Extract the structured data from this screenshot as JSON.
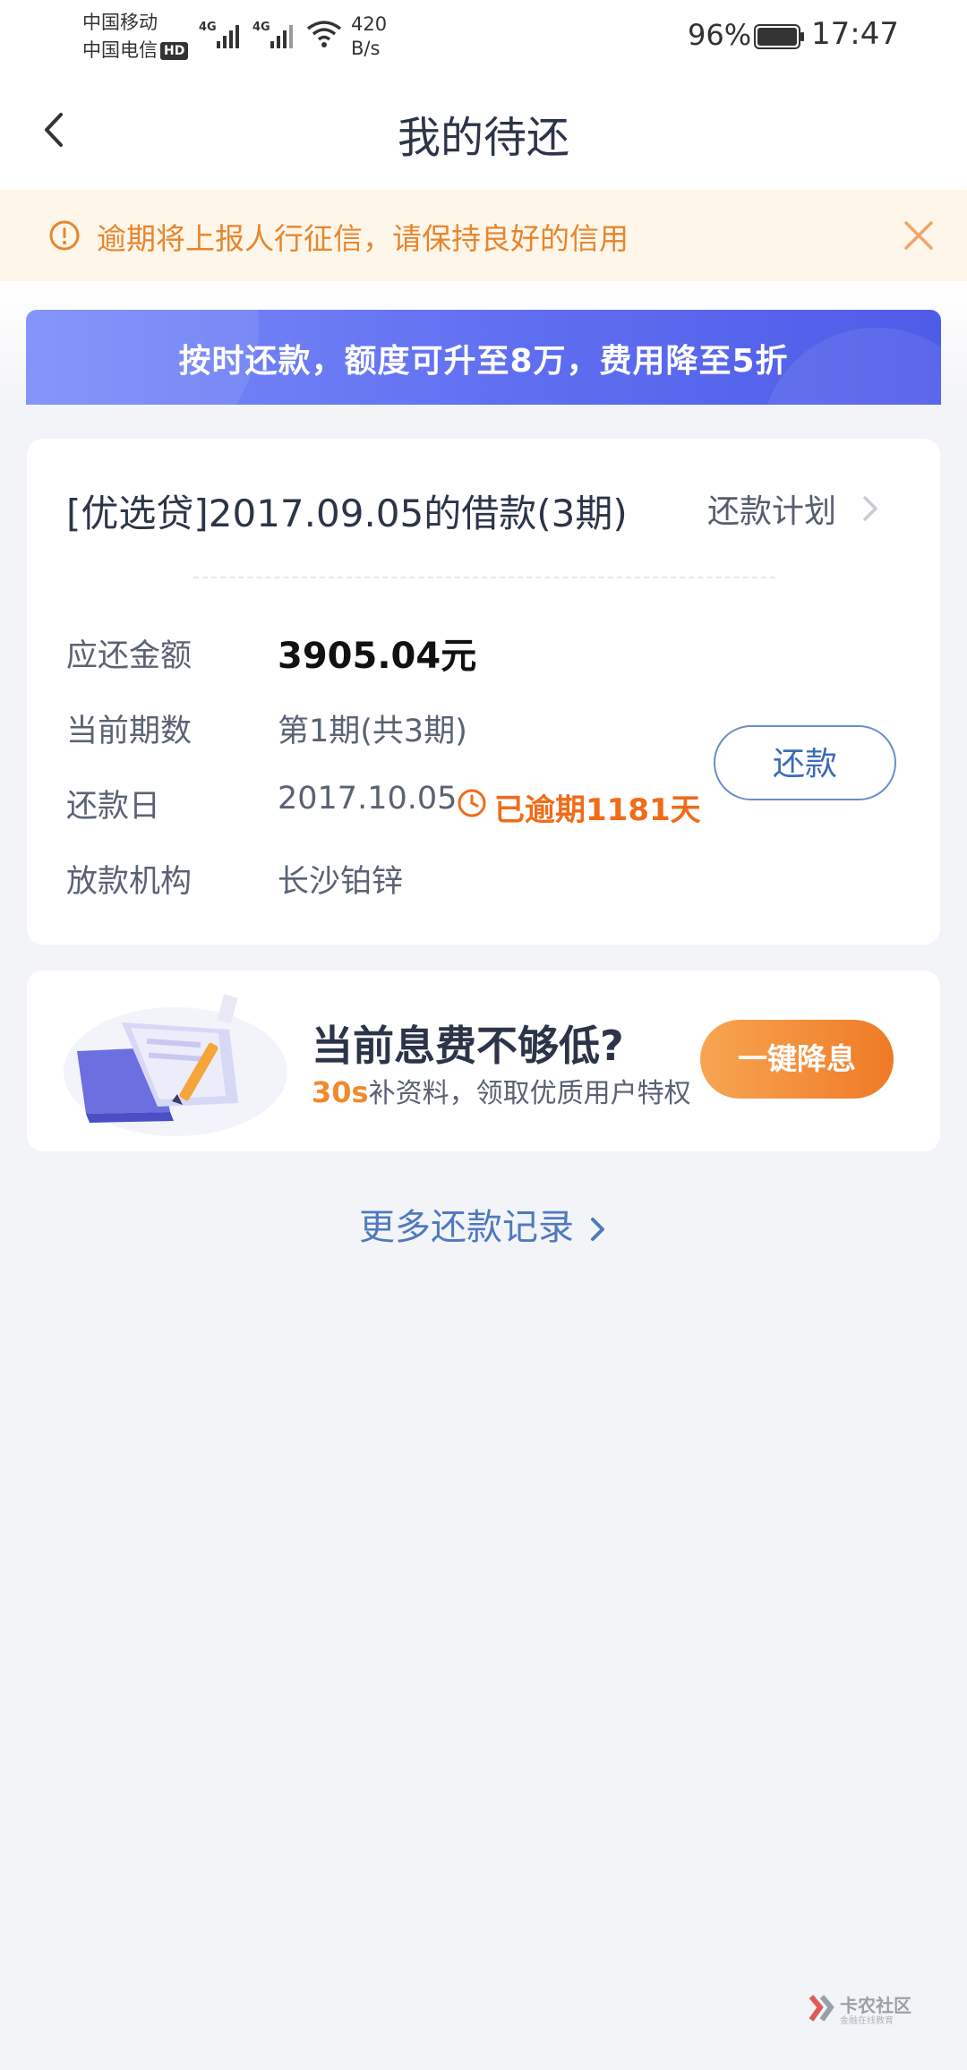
{
  "status_bar": {
    "carrier1": "中国移动",
    "carrier2": "中国电信",
    "hd_badge": "HD",
    "network1": "4G",
    "network2": "4G",
    "net_speed_value": "420",
    "net_speed_unit": "B/s",
    "battery": "96%",
    "time": "17:47"
  },
  "nav": {
    "title": "我的待还",
    "back_icon": "chevron-left-icon"
  },
  "notice": {
    "text": "逾期将上报人行征信，请保持良好的信用",
    "icon": "warning-circle-icon",
    "close_icon": "close-icon",
    "color": "#e6862e"
  },
  "banner": {
    "text": "按时还款，额度可升至8万，费用降至5折"
  },
  "loan": {
    "title": "[优选贷]2017.09.05的借款(3期)",
    "plan_link": "还款计划",
    "rows": [
      {
        "label": "应还金额",
        "value": "3905.04元"
      },
      {
        "label": "当前期数",
        "value": "第1期(共3期)"
      },
      {
        "label": "还款日",
        "value": "2017.10.05"
      },
      {
        "label": "放款机构",
        "value": "长沙铂锌"
      }
    ],
    "overdue_text": "已逾期1181天",
    "repay_button": "还款"
  },
  "promo": {
    "title": "当前息费不够低?",
    "sub_highlight": "30s",
    "sub_text": "补资料，领取优质用户特权",
    "button": "一键降息"
  },
  "more_records": "更多还款记录",
  "watermark": {
    "line1": "卡农社区",
    "line2": "金融在线教育"
  },
  "colors": {
    "accent_blue": "#4f7ac0",
    "overdue_orange": "#ef6c1a",
    "banner_start": "#7a8dfa",
    "banner_end": "#4e5ce8"
  }
}
